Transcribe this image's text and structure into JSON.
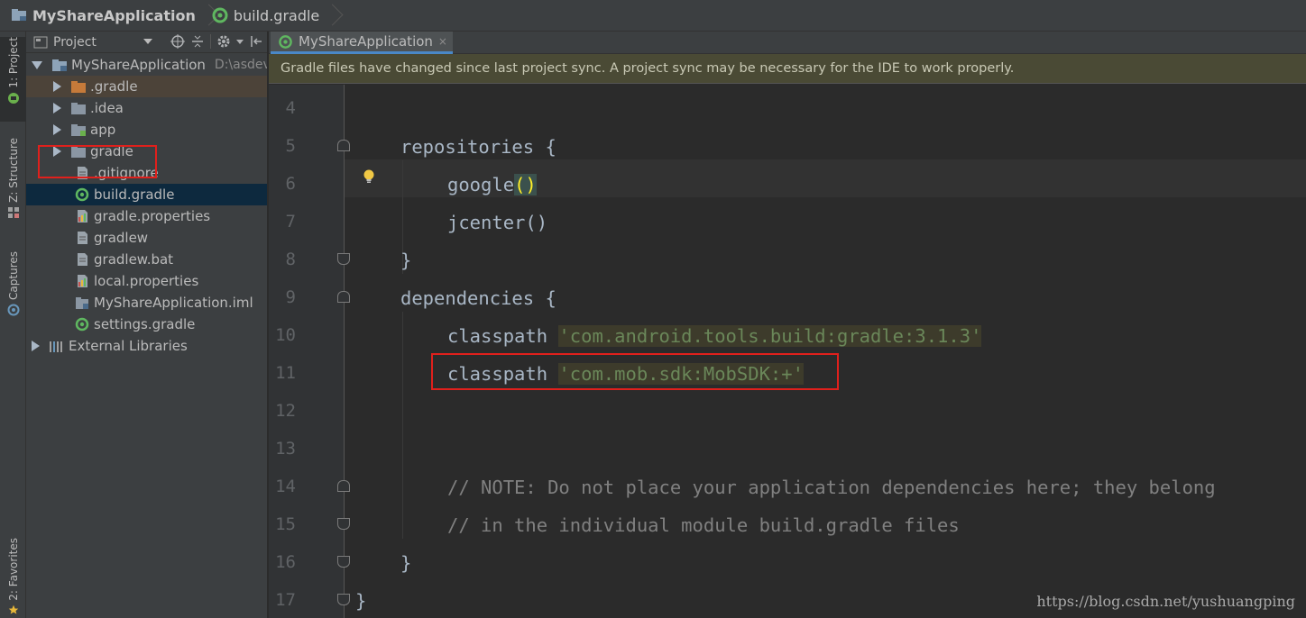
{
  "breadcrumb": {
    "project": "MyShareApplication",
    "file": "build.gradle"
  },
  "left_strip": {
    "tabs": [
      "1: Project",
      "Z: Structure",
      "Captures",
      "2: Favorites"
    ]
  },
  "project_panel": {
    "title": "Project",
    "tree": [
      {
        "label": "MyShareApplication",
        "path": "D:\\asdev",
        "expanded": true,
        "icon": "project-folder-icon"
      },
      {
        "label": ".gradle",
        "icon": "folder-orange-icon",
        "collapsed": true
      },
      {
        "label": ".idea",
        "icon": "folder-icon",
        "collapsed": true
      },
      {
        "label": "app",
        "icon": "module-folder-icon",
        "collapsed": true
      },
      {
        "label": "gradle",
        "icon": "folder-icon",
        "collapsed": true
      },
      {
        "label": ".gitignore",
        "icon": "file-icon"
      },
      {
        "label": "build.gradle",
        "icon": "gradle-icon",
        "selected": true
      },
      {
        "label": "gradle.properties",
        "icon": "properties-icon"
      },
      {
        "label": "gradlew",
        "icon": "file-icon"
      },
      {
        "label": "gradlew.bat",
        "icon": "file-icon"
      },
      {
        "label": "local.properties",
        "icon": "properties-icon"
      },
      {
        "label": "MyShareApplication.iml",
        "icon": "iml-icon"
      },
      {
        "label": "settings.gradle",
        "icon": "gradle-icon"
      },
      {
        "label": "External Libraries",
        "icon": "libraries-icon",
        "collapsed": true
      }
    ]
  },
  "editor": {
    "tab_label": "MyShareApplication",
    "tab_close": "×",
    "sync_banner": "Gradle files have changed since last project sync. A project sync may be necessary for the IDE to work properly.",
    "lines": [
      {
        "num": "4",
        "text": ""
      },
      {
        "num": "5",
        "text": "repositories {"
      },
      {
        "num": "6",
        "text": "google()"
      },
      {
        "num": "7",
        "text": "jcenter()"
      },
      {
        "num": "8",
        "text": "}"
      },
      {
        "num": "9",
        "text": "dependencies {"
      },
      {
        "num": "10",
        "kw": "classpath ",
        "str": "'com.android.tools.build:gradle:3.1.3'"
      },
      {
        "num": "11",
        "kw": "classpath ",
        "str": "'com.mob.sdk:MobSDK:+'"
      },
      {
        "num": "12",
        "text": ""
      },
      {
        "num": "13",
        "text": ""
      },
      {
        "num": "14",
        "text": "// NOTE: Do not place your application dependencies here; they belong"
      },
      {
        "num": "15",
        "text": "// in the individual module build.gradle files"
      },
      {
        "num": "16",
        "text": "}"
      },
      {
        "num": "17",
        "text": "}"
      }
    ]
  },
  "watermark": "https://blog.csdn.net/yushuangping",
  "colors": {
    "background": "#2b2b2b",
    "panel": "#3c3f41",
    "selection": "#0d293e",
    "string": "#6a8759",
    "comment": "#808080",
    "highlight_box": "#e0201c",
    "banner": "#4a4a35"
  }
}
